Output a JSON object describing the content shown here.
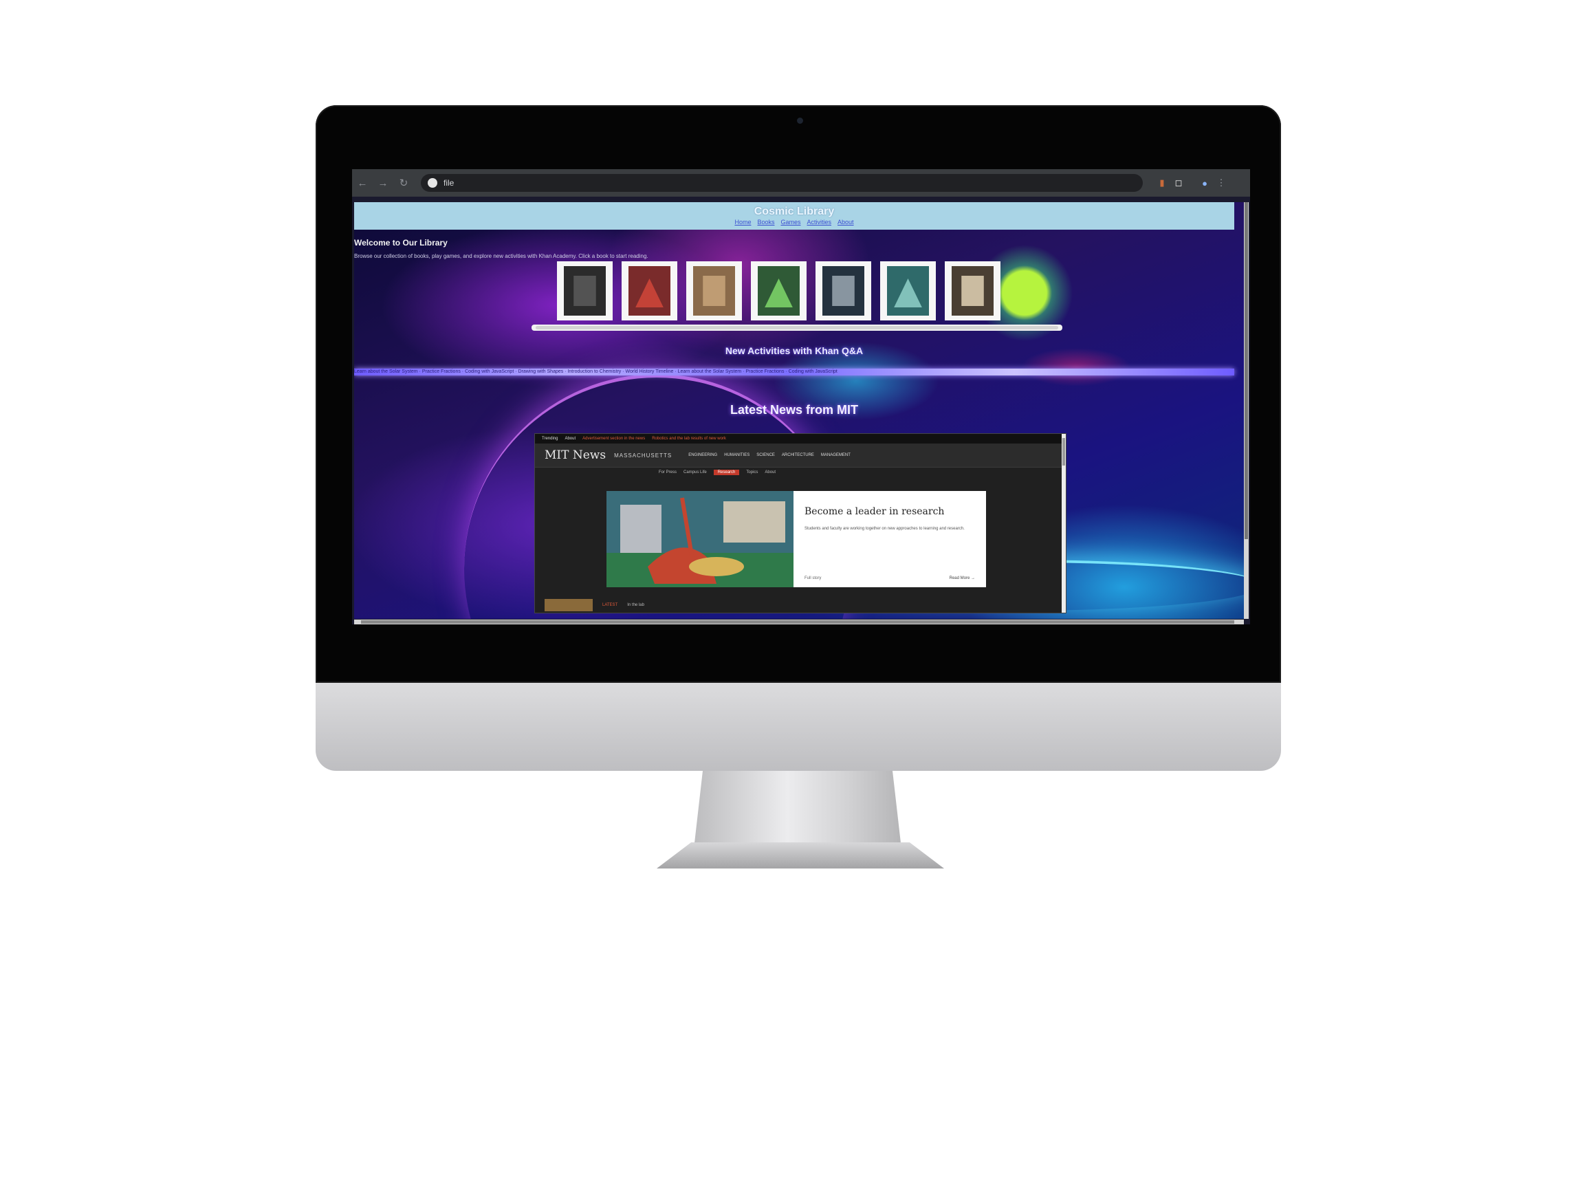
{
  "browser": {
    "address": "file",
    "nav": {
      "back": "←",
      "forward": "→",
      "reload": "↻"
    },
    "icons": [
      "site-info-icon",
      "extension-icon",
      "profile-icon",
      "menu-icon"
    ]
  },
  "site": {
    "title": "Cosmic Library",
    "nav_links": [
      "Home",
      "Books",
      "Games",
      "Activities",
      "About"
    ],
    "welcome_heading": "Welcome to Our Library",
    "welcome_text": "Browse our collection of books, play games, and explore new activities with Khan Academy. Click a book to start reading.",
    "activities_heading": "New Activities with Khan Q&A",
    "ticker": "Learn about the Solar System · Practice Fractions · Coding with JavaScript · Drawing with Shapes · Introduction to Chemistry · World History Timeline · Learn about the Solar System · Practice Fractions · Coding with JavaScript",
    "news_heading": "Latest News from MIT",
    "books": [
      {
        "cover": "#2b2b2b",
        "accent": "#5b5b5b"
      },
      {
        "cover": "#7a2b2b",
        "accent": "#d1463a"
      },
      {
        "cover": "#8a6a4a",
        "accent": "#c8a47a"
      },
      {
        "cover": "#2f5a36",
        "accent": "#7fd86a"
      },
      {
        "cover": "#24323f",
        "accent": "#9aa7b2"
      },
      {
        "cover": "#2f6a6a",
        "accent": "#8fd0c8"
      },
      {
        "cover": "#4a3f33",
        "accent": "#e2d2b5"
      }
    ]
  },
  "news": {
    "strip": [
      "Trending",
      "About",
      "Advertisement section in the news",
      "Robotics and the lab results of new work"
    ],
    "logo": "MIT News",
    "logo_sub": "MASSACHUSETTS",
    "nav": [
      "ENGINEERING",
      "HUMANITIES",
      "SCIENCE",
      "ARCHITECTURE",
      "MANAGEMENT"
    ],
    "subnav": [
      "For Press",
      "Campus Life",
      "Research",
      "Topics",
      "About"
    ],
    "active_subnav": "Research",
    "feature_title": "Become a leader in research",
    "feature_desc": "Students and faculty are working together on new approaches to learning and research.",
    "feature_meta": "Full story",
    "feature_read": "Read More →",
    "bottom_tag": "LATEST",
    "bottom_text": "In the lab"
  },
  "colors": {
    "header_bg": "#a9d4e6",
    "ticker": "#8a7cff",
    "accent": "#c43a2b"
  }
}
